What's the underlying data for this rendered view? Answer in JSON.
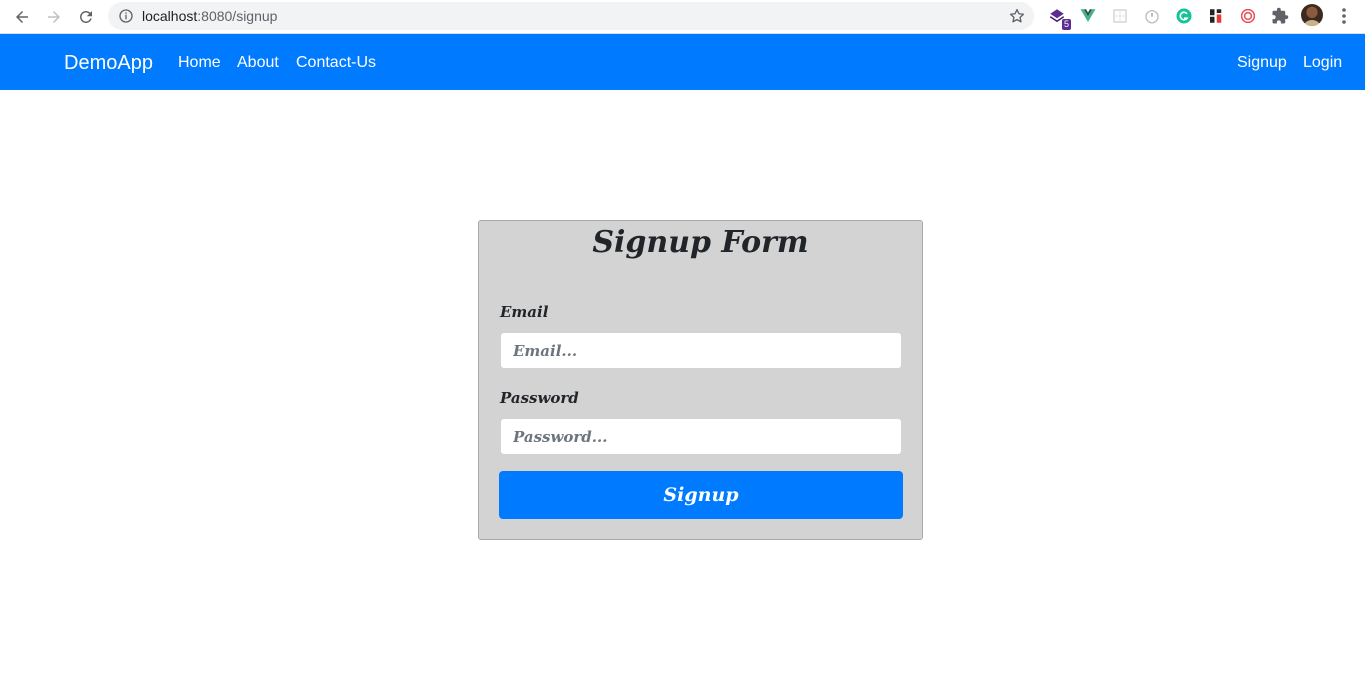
{
  "browser": {
    "url_host": "localhost",
    "url_path": ":8080/signup",
    "extension_badge": "5"
  },
  "colors": {
    "primary": "#007bff",
    "card_background": "#d3d3d3"
  },
  "navbar": {
    "brand": "DemoApp",
    "links": [
      {
        "label": "Home"
      },
      {
        "label": "About"
      },
      {
        "label": "Contact-Us"
      }
    ],
    "right_links": [
      {
        "label": "Signup"
      },
      {
        "label": "Login"
      }
    ]
  },
  "form": {
    "title": "Signup Form",
    "email": {
      "label": "Email",
      "placeholder": "Email..."
    },
    "password": {
      "label": "Password",
      "placeholder": "Password..."
    },
    "submit_label": "Signup"
  }
}
